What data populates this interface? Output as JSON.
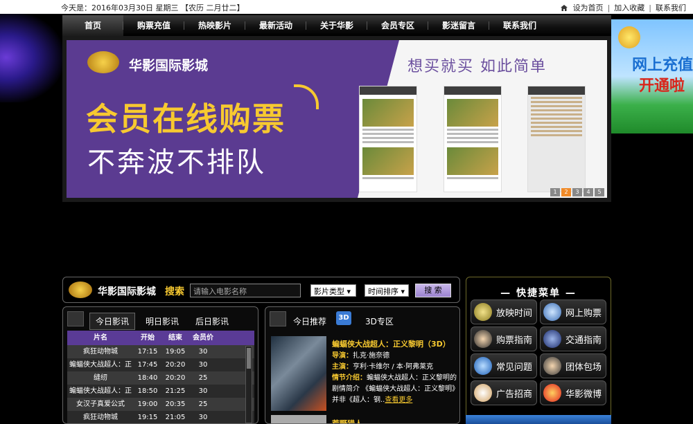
{
  "topbar": {
    "date": "今天是：2016年03月30日   星期三 【农历  二月廿二】",
    "set_home": "设为首页",
    "favorite": "加入收藏",
    "contact": "联系我们"
  },
  "nav": [
    "首页",
    "购票充值",
    "热映影片",
    "最新活动",
    "关于华影",
    "会员专区",
    "影迷留言",
    "联系我们"
  ],
  "banner": {
    "brand": "华影国际影城",
    "slogan": "想买就买   如此简单",
    "headline": "会员在线购票",
    "subline": "不奔波不排队",
    "slides": [
      "1",
      "2",
      "3",
      "4",
      "5"
    ],
    "active_slide": 2
  },
  "side_ad": {
    "line1": "网上充值",
    "line2": "开通啦"
  },
  "search": {
    "brand": "华影国际影城",
    "keyword": "搜索",
    "placeholder": "请输入电影名称",
    "type_select": "影片类型",
    "sort_select": "时间排序",
    "button": "搜 索"
  },
  "quick_menu": {
    "title": "— 快捷菜单 —",
    "items": [
      "放映时间",
      "网上购票",
      "购票指南",
      "交通指南",
      "常见问题",
      "团体包场",
      "广告招商",
      "华影微博"
    ]
  },
  "schedule": {
    "tabs": [
      "今日影讯",
      "明日影讯",
      "后日影讯"
    ],
    "headers": [
      "片名",
      "开始",
      "结束",
      "会员价"
    ],
    "rows": [
      [
        "疯狂动物城",
        "17:15",
        "19:05",
        "30"
      ],
      [
        "蝙蝠侠大战超人：正",
        "17:45",
        "20:20",
        "30"
      ],
      [
        "缝纫",
        "18:40",
        "20:20",
        "25"
      ],
      [
        "蝙蝠侠大战超人：正",
        "18:50",
        "21:25",
        "30"
      ],
      [
        "女汉子真爱公式",
        "19:00",
        "20:35",
        "25"
      ],
      [
        "疯狂动物城",
        "19:15",
        "21:05",
        "30"
      ]
    ]
  },
  "recommend": {
    "tabs": [
      "今日推荐",
      "3D专区"
    ],
    "badge": "3D",
    "title": "蝙蝠侠大战超人：正义黎明（3D）",
    "director_label": "导演：",
    "director": "扎克·施奈德",
    "cast_label": "主演：",
    "cast": "亨利·卡维尔 / 本·阿弗莱克",
    "plot_label": "情节介绍：",
    "plot": "蝙蝠侠大战超人：正义黎明的剧情简介          《蝙蝠侠大战超人：正义黎明》并非《超人：钢..",
    "more": "查看更多",
    "next_title": "荒野猎人"
  }
}
